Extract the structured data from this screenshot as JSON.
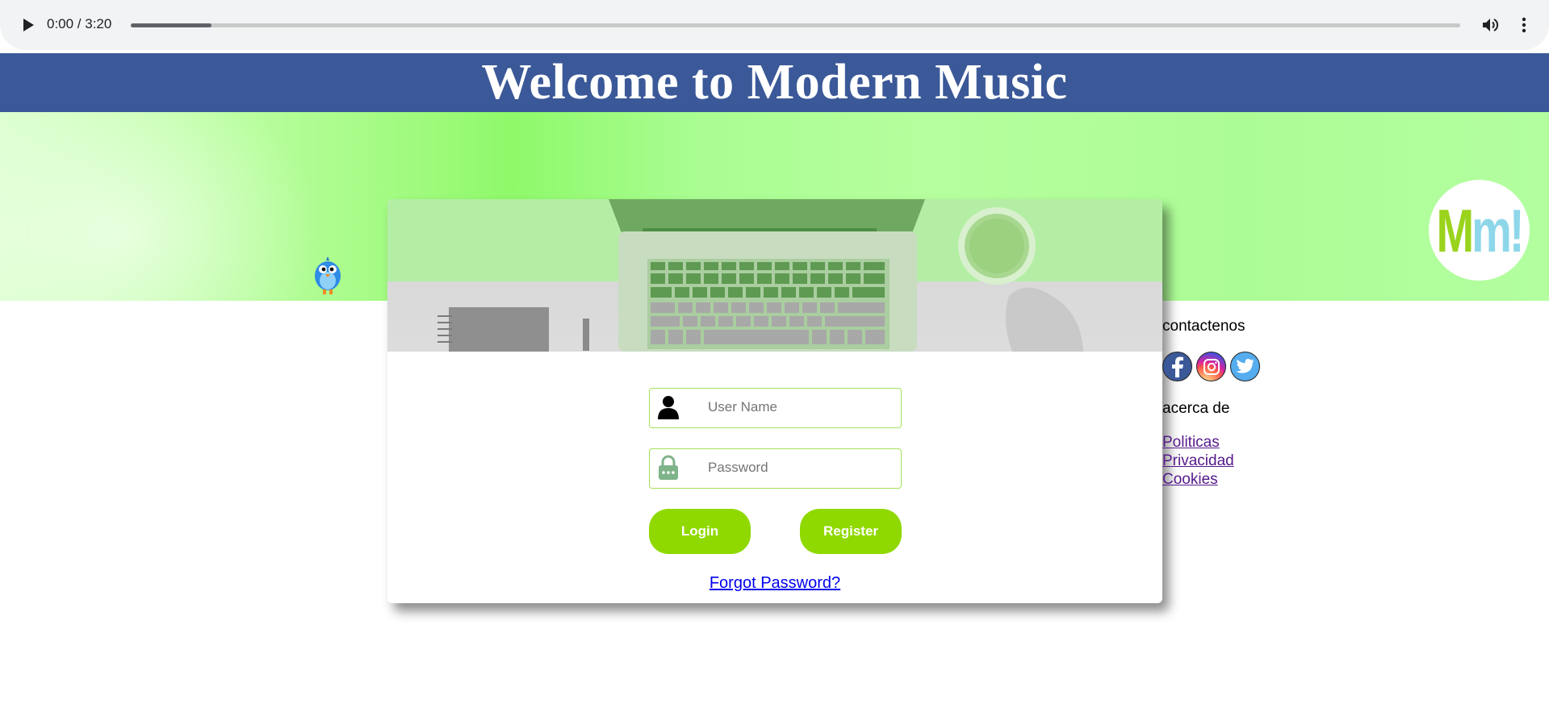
{
  "audio": {
    "time": "0:00 / 3:20",
    "buffered_fraction": 0.061
  },
  "header": {
    "title": "Welcome to Modern Music"
  },
  "brand": {
    "logo_m1": "M",
    "logo_m2": "m",
    "logo_bang": "!"
  },
  "login": {
    "username_placeholder": "User Name",
    "password_placeholder": "Password",
    "login_label": "Login",
    "register_label": "Register",
    "forgot_label": "Forgot Password?"
  },
  "side": {
    "contact_heading": "contactenos",
    "about_heading": "acerca de",
    "links": [
      "Politicas",
      "Privacidad",
      "Cookies"
    ]
  },
  "colors": {
    "header_bg": "#3b5998",
    "accent_green": "#8fd900",
    "input_border": "#a6e05a"
  },
  "icons": [
    "play-icon",
    "volume-icon",
    "more-vert-icon",
    "user-icon",
    "lock-icon",
    "facebook-icon",
    "instagram-icon",
    "twitter-icon",
    "bird-mascot-icon"
  ]
}
